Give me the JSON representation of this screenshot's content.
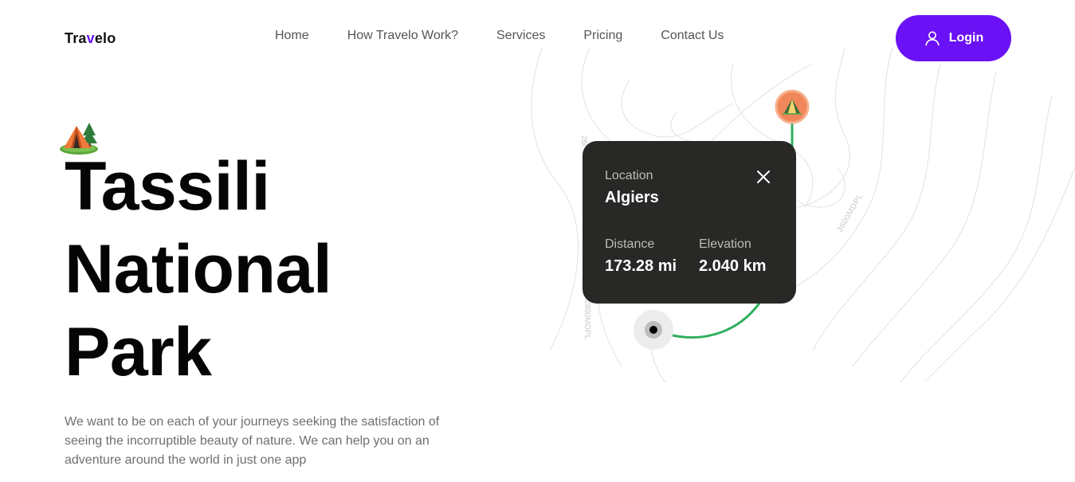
{
  "header": {
    "logo_prefix": "Tra",
    "logo_accent": "v",
    "logo_suffix": "elo",
    "nav": [
      "Home",
      "How Travelo Work?",
      "Services",
      "Pricing",
      "Contact Us"
    ],
    "login_label": "Login"
  },
  "hero": {
    "title_lines": [
      "Tassili",
      "National",
      "Park"
    ],
    "description": "We want to be on each of your journeys seeking the satisfaction of seeing the incorruptible beauty of nature. We can help you on an adventure around the world in just one app"
  },
  "map": {
    "contour_labels": [
      "3600MDPL",
      "2600MDPL",
      "2800MDPL"
    ],
    "card": {
      "location_label": "Location",
      "location_value": "Algiers",
      "distance_label": "Distance",
      "distance_value": "173.28 mi",
      "elevation_label": "Elevation",
      "elevation_value": "2.040 km"
    }
  },
  "icons": [
    "tent-icon",
    "user-icon",
    "close-icon",
    "tent-pin-icon",
    "start-point-icon"
  ],
  "colors": {
    "accent": "#6a11f5",
    "card_bg": "#282826",
    "route": "#2fae5c",
    "pin": "#f0875a"
  }
}
